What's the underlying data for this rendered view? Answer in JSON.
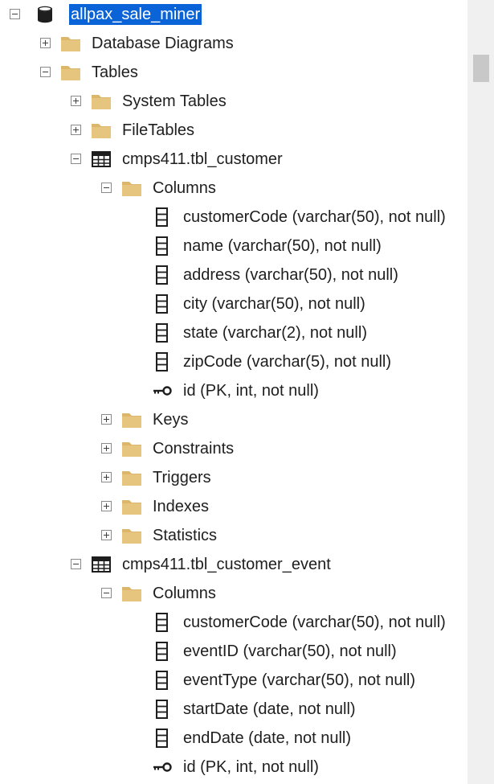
{
  "tree": {
    "rows": [
      {
        "label": "allpax_sale_miner",
        "icon": "database-icon",
        "level": 0,
        "toggle": "collapse",
        "selected": true
      },
      {
        "label": "Database Diagrams",
        "icon": "folder-icon",
        "level": 1,
        "toggle": "expand"
      },
      {
        "label": "Tables",
        "icon": "folder-icon",
        "level": 1,
        "toggle": "collapse"
      },
      {
        "label": "System Tables",
        "icon": "folder-icon",
        "level": 2,
        "toggle": "expand"
      },
      {
        "label": "FileTables",
        "icon": "folder-icon",
        "level": 2,
        "toggle": "expand"
      },
      {
        "label": "cmps411.tbl_customer",
        "icon": "table-icon",
        "level": 2,
        "toggle": "collapse"
      },
      {
        "label": "Columns",
        "icon": "folder-icon",
        "level": 3,
        "toggle": "collapse"
      },
      {
        "label": "customerCode (varchar(50), not null)",
        "icon": "column-icon",
        "level": 4,
        "toggle": "none"
      },
      {
        "label": "name (varchar(50), not null)",
        "icon": "column-icon",
        "level": 4,
        "toggle": "none"
      },
      {
        "label": "address (varchar(50), not null)",
        "icon": "column-icon",
        "level": 4,
        "toggle": "none"
      },
      {
        "label": "city (varchar(50), not null)",
        "icon": "column-icon",
        "level": 4,
        "toggle": "none"
      },
      {
        "label": "state (varchar(2), not null)",
        "icon": "column-icon",
        "level": 4,
        "toggle": "none"
      },
      {
        "label": "zipCode (varchar(5), not null)",
        "icon": "column-icon",
        "level": 4,
        "toggle": "none"
      },
      {
        "label": "id (PK, int, not null)",
        "icon": "key-icon",
        "level": 4,
        "toggle": "none"
      },
      {
        "label": "Keys",
        "icon": "folder-icon",
        "level": 3,
        "toggle": "expand"
      },
      {
        "label": "Constraints",
        "icon": "folder-icon",
        "level": 3,
        "toggle": "expand"
      },
      {
        "label": "Triggers",
        "icon": "folder-icon",
        "level": 3,
        "toggle": "expand"
      },
      {
        "label": "Indexes",
        "icon": "folder-icon",
        "level": 3,
        "toggle": "expand"
      },
      {
        "label": "Statistics",
        "icon": "folder-icon",
        "level": 3,
        "toggle": "expand"
      },
      {
        "label": "cmps411.tbl_customer_event",
        "icon": "table-icon",
        "level": 2,
        "toggle": "collapse"
      },
      {
        "label": "Columns",
        "icon": "folder-icon",
        "level": 3,
        "toggle": "collapse"
      },
      {
        "label": "customerCode (varchar(50), not null)",
        "icon": "column-icon",
        "level": 4,
        "toggle": "none"
      },
      {
        "label": "eventID (varchar(50), not null)",
        "icon": "column-icon",
        "level": 4,
        "toggle": "none"
      },
      {
        "label": "eventType (varchar(50), not null)",
        "icon": "column-icon",
        "level": 4,
        "toggle": "none"
      },
      {
        "label": "startDate (date, not null)",
        "icon": "column-icon",
        "level": 4,
        "toggle": "none"
      },
      {
        "label": "endDate (date, not null)",
        "icon": "column-icon",
        "level": 4,
        "toggle": "none"
      },
      {
        "label": "id (PK, int, not null)",
        "icon": "key-icon",
        "level": 4,
        "toggle": "none"
      }
    ]
  },
  "colors": {
    "folder": "#dcb66b",
    "selection": "#0a64d8",
    "text": "#1e1e1e",
    "scrollbar_track": "#f0f0f0",
    "scrollbar_thumb": "#c8c8c8"
  }
}
